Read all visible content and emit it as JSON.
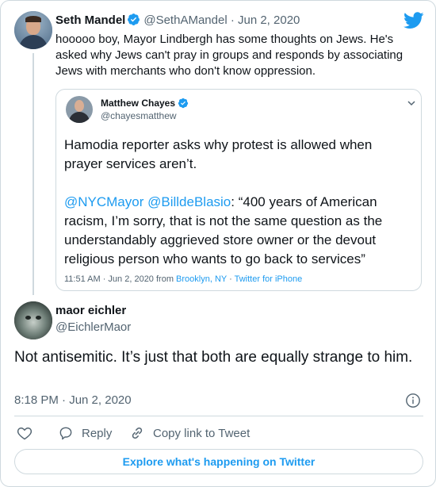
{
  "colors": {
    "accent": "#1d9bf0",
    "text": "#0f1419",
    "muted": "#536471",
    "border": "#cfd9de"
  },
  "parent_tweet": {
    "name": "Seth Mandel",
    "handle_date": "@SethAMandel · Jun 2, 2020",
    "text": "hooooo boy, Mayor Lindbergh has some thoughts on Jews. He's asked why Jews can't pray in groups and responds by associating Jews with merchants who don't know oppression."
  },
  "quoted_tweet": {
    "name": "Matthew Chayes",
    "handle": "@chayesmatthew",
    "text_part1": "Hamodia reporter asks why protest is allowed when prayer services aren’t.",
    "mention1": "@NYCMayor",
    "mention2": "@BilldeBlasio",
    "text_part2": ": “400 years of American racism, I’m sorry, that is not the same question as the understandably aggrieved store owner or the devout religious person who wants to go back to services”",
    "meta_time": "11:51 AM · Jun 2, 2020 from ",
    "meta_location": "Brooklyn, NY",
    "meta_sep": " · ",
    "meta_source": "Twitter for iPhone"
  },
  "reply_tweet": {
    "name": "maor eichler",
    "handle": "@EichlerMaor",
    "text": "Not antisemitic. It’s just that both are equally strange to him.",
    "timestamp": "8:18 PM · Jun 2, 2020"
  },
  "actions": {
    "reply_label": "Reply",
    "copy_label": "Copy link to Tweet"
  },
  "explore_label": "Explore what's happening on Twitter",
  "icons": [
    "verified-icon",
    "twitter-bird-icon",
    "chevron-down-icon",
    "info-icon",
    "heart-icon",
    "reply-bubble-icon",
    "link-icon"
  ]
}
